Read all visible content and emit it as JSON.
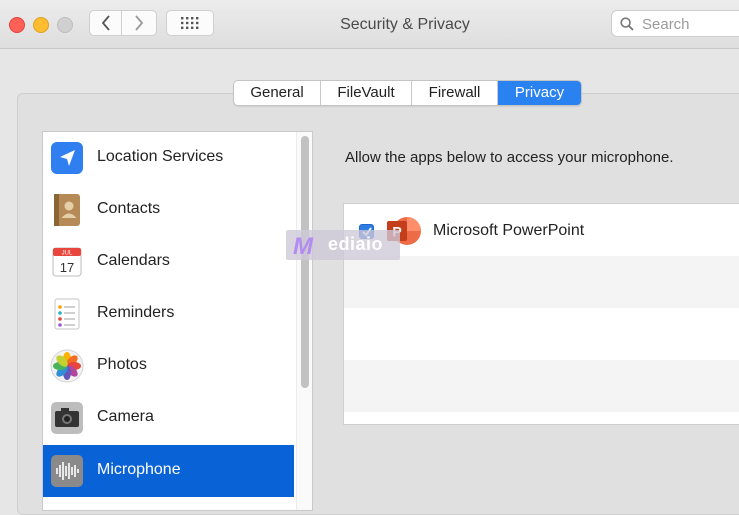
{
  "window": {
    "title": "Security & Privacy",
    "search_placeholder": "Search"
  },
  "icons": {
    "back": "chevron-left-icon",
    "forward": "chevron-right-icon",
    "show_all": "grid-icon",
    "search": "magnifier-icon"
  },
  "tabs": [
    {
      "label": "General",
      "active": false
    },
    {
      "label": "FileVault",
      "active": false
    },
    {
      "label": "Firewall",
      "active": false
    },
    {
      "label": "Privacy",
      "active": true
    }
  ],
  "sidebar": {
    "items": [
      {
        "label": "Location Services",
        "icon": "location-arrow-icon"
      },
      {
        "label": "Contacts",
        "icon": "contacts-book-icon"
      },
      {
        "label": "Calendars",
        "icon": "calendar-icon",
        "icon_text_month": "JUL",
        "icon_text_day": "17"
      },
      {
        "label": "Reminders",
        "icon": "reminders-list-icon"
      },
      {
        "label": "Photos",
        "icon": "photos-flower-icon"
      },
      {
        "label": "Camera",
        "icon": "camera-icon"
      },
      {
        "label": "Microphone",
        "icon": "microphone-waveform-icon",
        "selected": true
      }
    ]
  },
  "content": {
    "prompt": "Allow the apps below to access your microphone.",
    "apps": [
      {
        "name": "Microsoft PowerPoint",
        "checked": true,
        "icon": "powerpoint-icon",
        "icon_letter": "P"
      }
    ]
  },
  "watermark": {
    "text": "ediaio",
    "logo_letter": "M"
  },
  "colors": {
    "accent": "#2a82f0",
    "selected_row": "#0a63d6",
    "close": "#fe5f57",
    "minimize": "#febc2e",
    "powerpoint": "#d24726"
  }
}
